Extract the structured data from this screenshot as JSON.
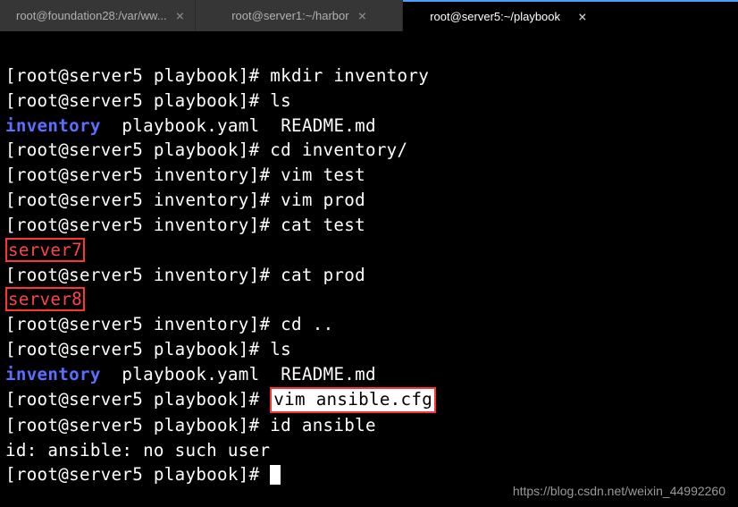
{
  "tabs": [
    {
      "title": "root@foundation28:/var/ww...",
      "active": false
    },
    {
      "title": "root@server1:~/harbor",
      "active": false
    },
    {
      "title": "root@server5:~/playbook",
      "active": true
    }
  ],
  "prompt_playbook": "[root@server5 playbook]# ",
  "prompt_inventory": "[root@server5 inventory]# ",
  "commands": {
    "mkdir": "mkdir inventory",
    "ls": "ls",
    "cd_inventory": "cd inventory/",
    "vim_test": "vim test",
    "vim_prod": "vim prod",
    "cat_test": "cat test",
    "cat_prod": "cat prod",
    "cd_up": "cd ..",
    "vim_ansible": "vim ansible.cfg",
    "id_ansible": "id ansible"
  },
  "output": {
    "server7": "server7",
    "server8": "server8",
    "ls1": {
      "inventory": "inventory",
      "playbook": "playbook.yaml",
      "readme": "README.md"
    },
    "id_error": "id: ansible: no such user"
  },
  "watermark": "https://blog.csdn.net/weixin_44992260"
}
